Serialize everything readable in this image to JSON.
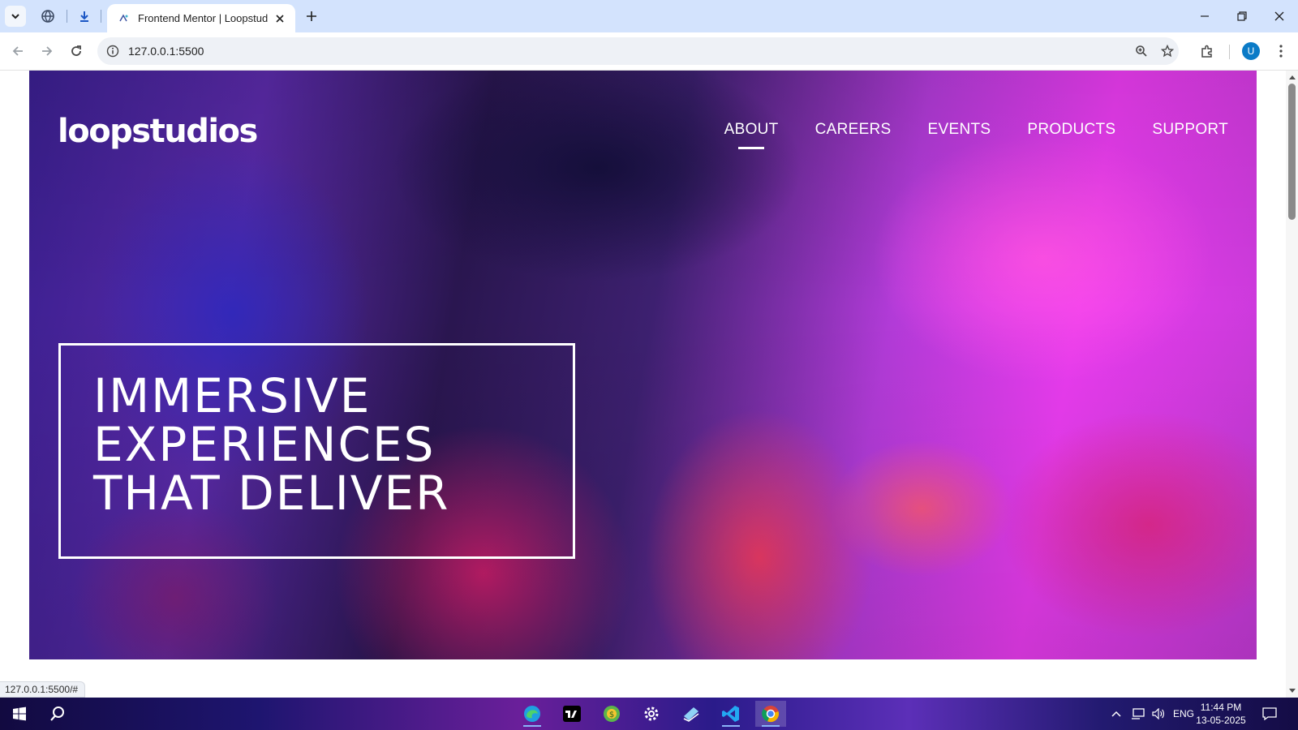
{
  "browser": {
    "tab": {
      "title": "Frontend Mentor | Loopstudios"
    },
    "address_bar": {
      "url": "127.0.0.1:5500"
    },
    "profile_initial": "U",
    "status_url": "127.0.0.1:5500/#"
  },
  "page": {
    "logo": "loopstudios",
    "nav": [
      {
        "label": "ABOUT",
        "active": true
      },
      {
        "label": "CAREERS",
        "active": false
      },
      {
        "label": "EVENTS",
        "active": false
      },
      {
        "label": "PRODUCTS",
        "active": false
      },
      {
        "label": "SUPPORT",
        "active": false
      }
    ],
    "headline": [
      "IMMERSIVE",
      "EXPERIENCES",
      "THAT DELIVER"
    ]
  },
  "taskbar": {
    "language": "ENG",
    "time": "11:44 PM",
    "date": "13-05-2025",
    "apps": [
      "edge-icon",
      "tradingview-icon",
      "money-app-icon",
      "settings-icon",
      "files-icon",
      "vscode-icon",
      "chrome-icon"
    ]
  },
  "colors": {
    "tabstrip": "#d3e3fd",
    "avatar": "#0b7bc7",
    "hero_text": "#ffffff"
  }
}
